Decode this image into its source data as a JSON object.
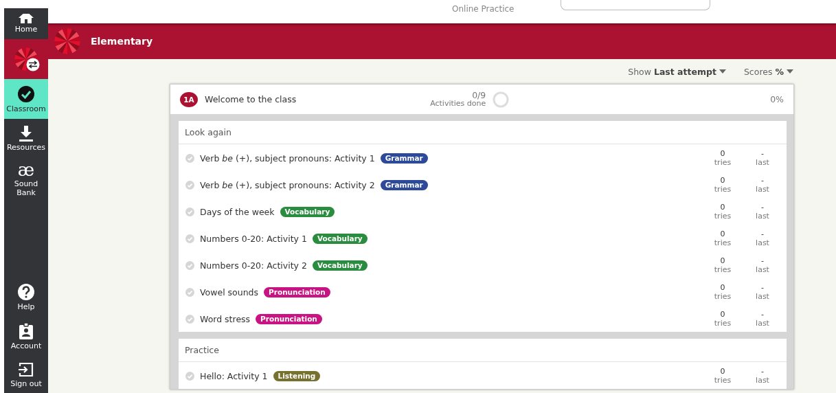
{
  "header": {
    "site_label": "Online Practice"
  },
  "sidebar": {
    "items": [
      {
        "kind": "home",
        "label": "Home",
        "selected": false
      },
      {
        "kind": "switch",
        "selected": false
      },
      {
        "kind": "classroom",
        "label": "Classroom",
        "selected": true
      },
      {
        "kind": "resources",
        "label": "Resources",
        "selected": false
      },
      {
        "kind": "soundbank",
        "glyph": "æ",
        "label": "Sound Bank",
        "selected": false
      },
      {
        "kind": "help",
        "label": "Help",
        "selected": false
      },
      {
        "kind": "account",
        "label": "Account",
        "selected": false
      },
      {
        "kind": "signout",
        "label": "Sign out",
        "selected": false
      }
    ]
  },
  "course_bar": {
    "title": "Elementary"
  },
  "filters": {
    "show_label": "Show",
    "show_value": "Last attempt",
    "scores_label": "Scores",
    "scores_value": "%"
  },
  "unit": {
    "badge": "1A",
    "title": "Welcome to the class",
    "done": "0/9",
    "done_label": "Activities done",
    "level": 0,
    "score": "0%",
    "sections": [
      {
        "title": "Look again",
        "activities": [
          {
            "title": "Verb *be* (+), subject pronouns: Activity 1",
            "tag": "Grammar",
            "color": "#2d4a98",
            "tries": "0",
            "tries_label": "tries",
            "last": "-",
            "last_label": "last"
          },
          {
            "title": "Verb *be* (+), subject pronouns: Activity 2",
            "tag": "Grammar",
            "color": "#2d4a98",
            "tries": "0",
            "tries_label": "tries",
            "last": "-",
            "last_label": "last"
          },
          {
            "title": "Days of the week",
            "tag": "Vocabulary",
            "color": "#2a8c3f",
            "tries": "0",
            "tries_label": "tries",
            "last": "-",
            "last_label": "last"
          },
          {
            "title": "Numbers 0-20: Activity 1",
            "tag": "Vocabulary",
            "color": "#2a8c3f",
            "tries": "0",
            "tries_label": "tries",
            "last": "-",
            "last_label": "last"
          },
          {
            "title": "Numbers 0-20: Activity 2",
            "tag": "Vocabulary",
            "color": "#2a8c3f",
            "tries": "0",
            "tries_label": "tries",
            "last": "-",
            "last_label": "last"
          },
          {
            "title": "Vowel sounds",
            "tag": "Pronunciation",
            "color": "#c81482",
            "tries": "0",
            "tries_label": "tries",
            "last": "-",
            "last_label": "last"
          },
          {
            "title": "Word stress",
            "tag": "Pronunciation",
            "color": "#c81482",
            "tries": "0",
            "tries_label": "tries",
            "last": "-",
            "last_label": "last"
          }
        ]
      },
      {
        "title": "Practice",
        "activities": [
          {
            "title": "Hello: Activity 1",
            "tag": "Listening",
            "color": "#76712f",
            "tries": "0",
            "tries_label": "tries",
            "last": "-",
            "last_label": "last"
          }
        ]
      }
    ]
  }
}
